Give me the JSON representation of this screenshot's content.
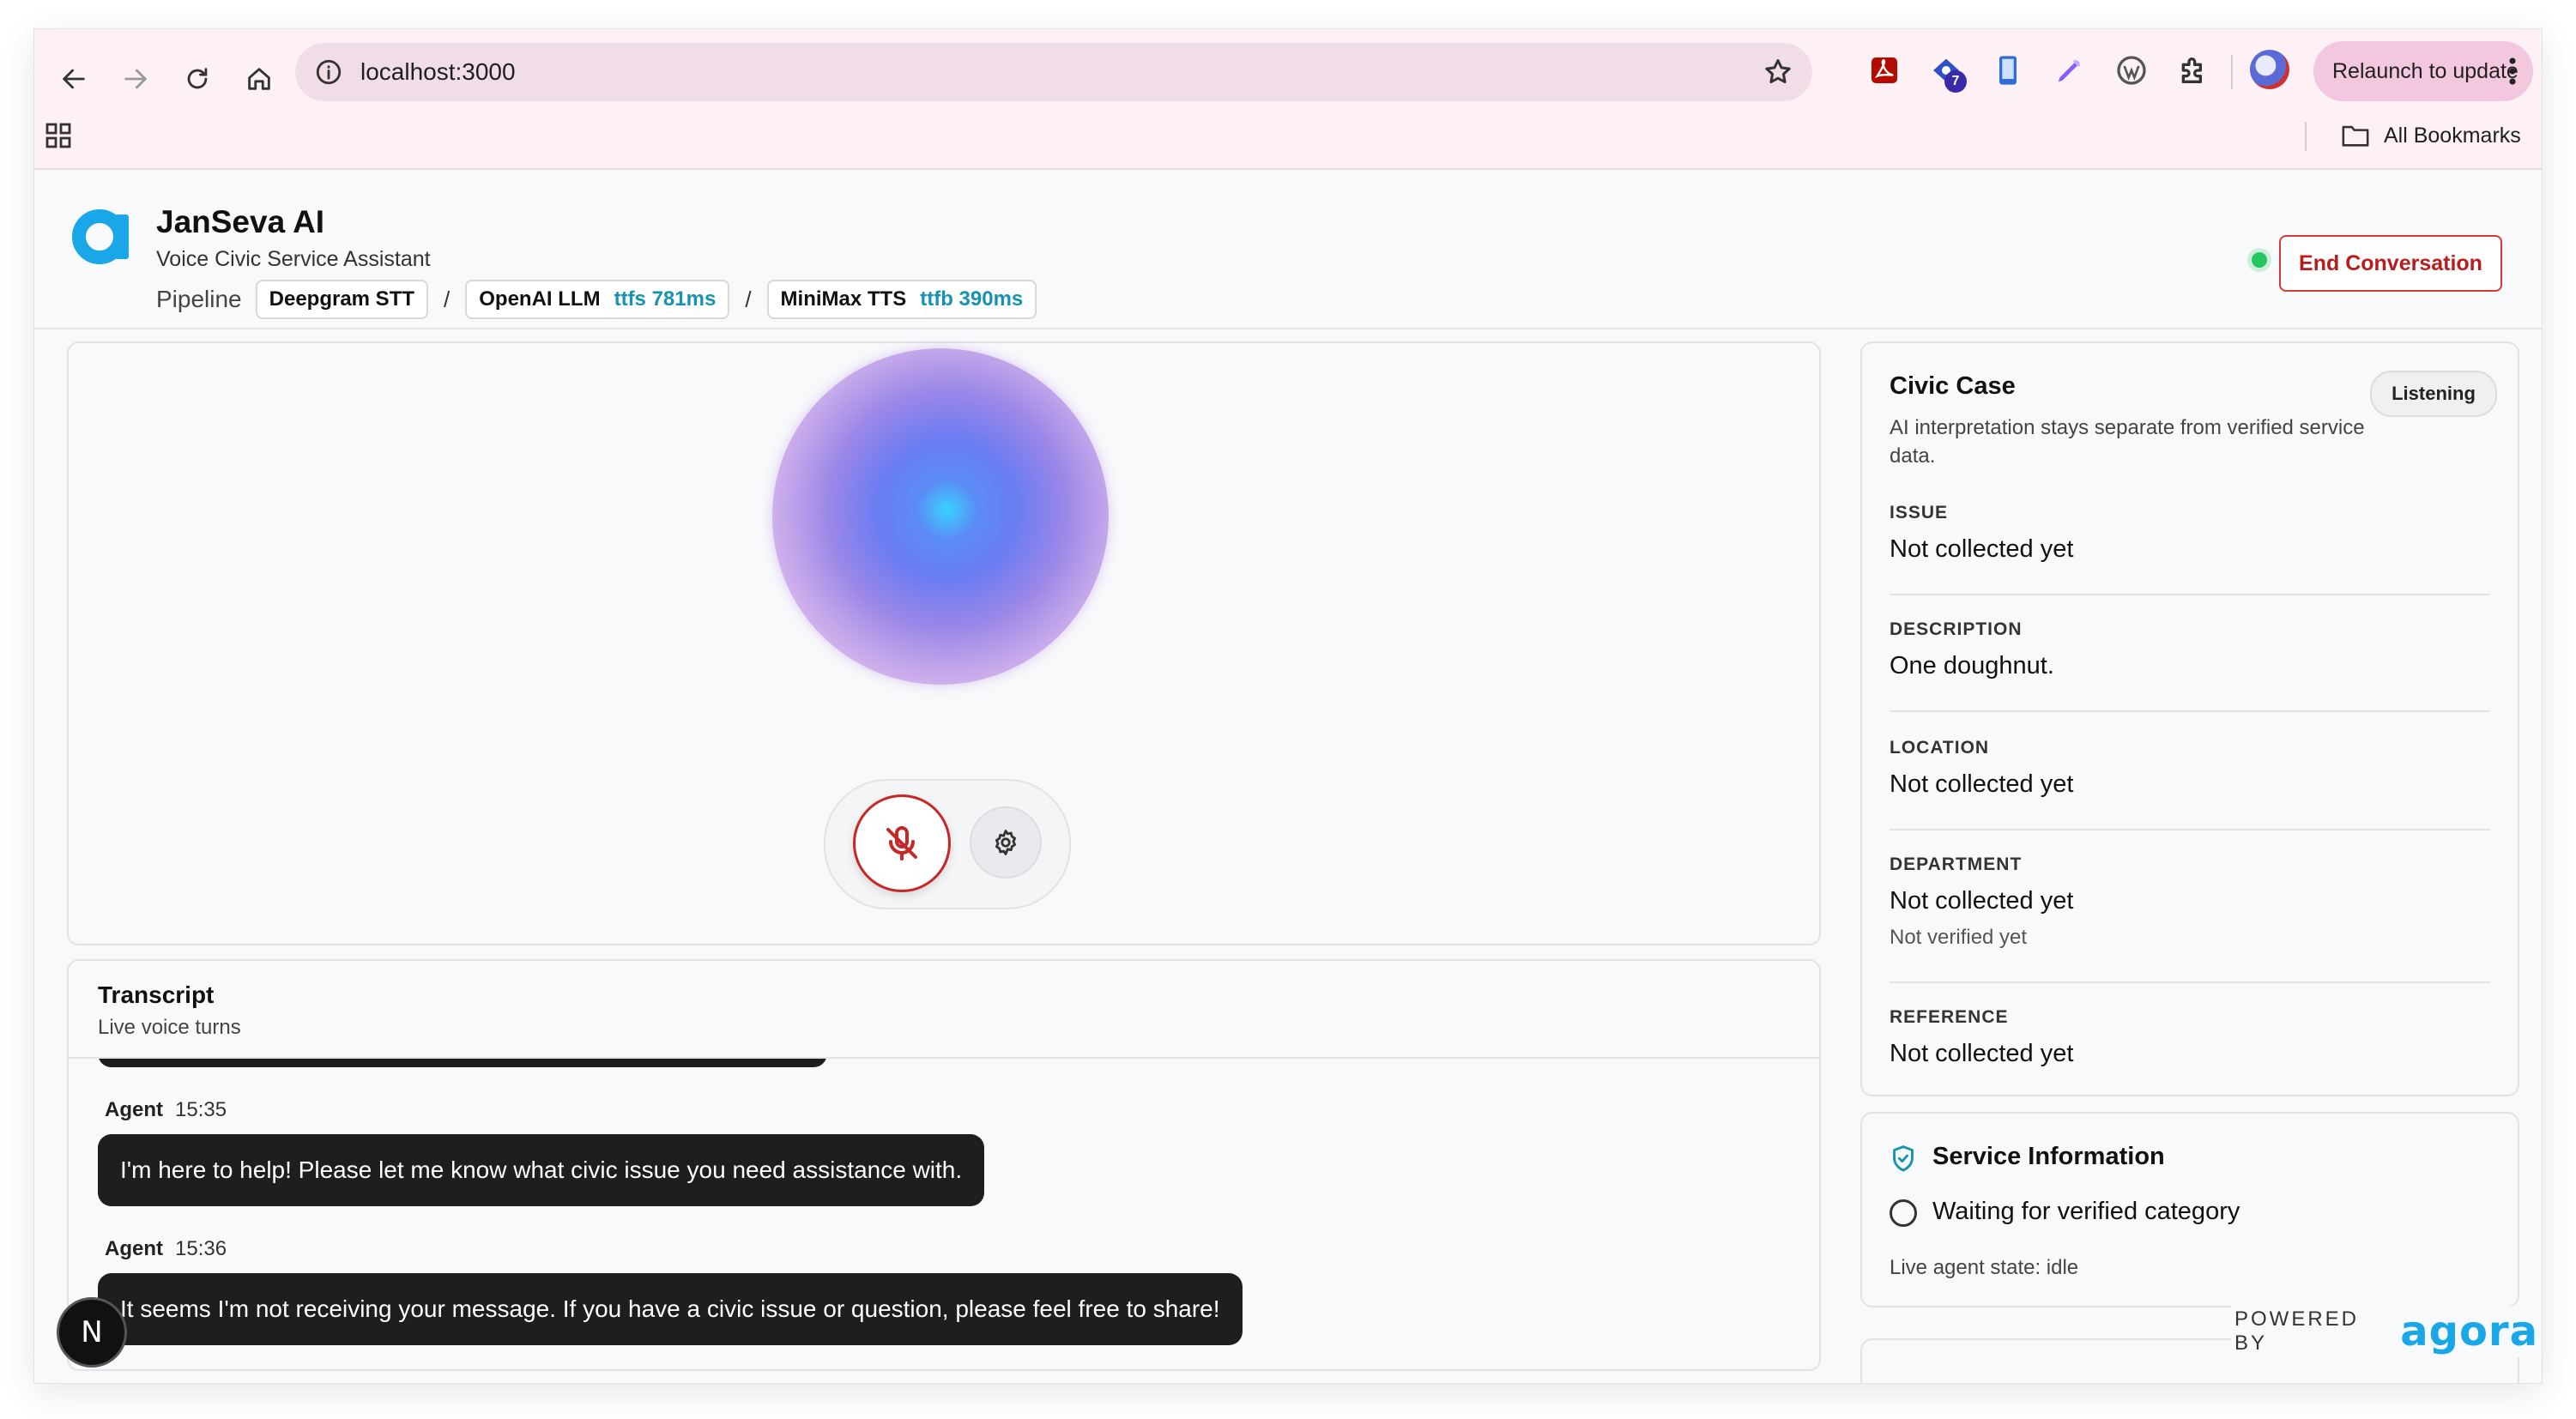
{
  "browser": {
    "url": "localhost:3000",
    "relaunch_label": "Relaunch to update",
    "extension_badge": "7",
    "bookmarks_label": "All Bookmarks"
  },
  "header": {
    "title": "JanSeva AI",
    "subtitle": "Voice Civic Service Assistant",
    "pipeline_label": "Pipeline",
    "pipeline": [
      {
        "name": "Deepgram STT",
        "metric": ""
      },
      {
        "name": "OpenAI LLM",
        "metric": "ttfs 781ms"
      },
      {
        "name": "MiniMax TTS",
        "metric": "ttfb 390ms"
      }
    ],
    "separator": "/",
    "end_button": "End Conversation",
    "status_color": "#22c55e"
  },
  "transcript": {
    "title": "Transcript",
    "subtitle": "Live voice turns",
    "messages": [
      {
        "speaker": "Agent",
        "time": "15:35",
        "text": "I'm here to help! Please let me know what civic issue you need assistance with."
      },
      {
        "speaker": "Agent",
        "time": "15:36",
        "text": "It seems I'm not receiving your message. If you have a civic issue or question, please feel free to share!"
      }
    ]
  },
  "civic_case": {
    "title": "Civic Case",
    "description": "AI interpretation stays separate from verified service data.",
    "status_badge": "Listening",
    "fields": [
      {
        "label": "ISSUE",
        "value": "Not collected yet",
        "note": ""
      },
      {
        "label": "DESCRIPTION",
        "value": "One doughnut.",
        "note": ""
      },
      {
        "label": "LOCATION",
        "value": "Not collected yet",
        "note": ""
      },
      {
        "label": "DEPARTMENT",
        "value": "Not collected yet",
        "note": "Not verified yet"
      },
      {
        "label": "REFERENCE",
        "value": "Not collected yet",
        "note": ""
      }
    ]
  },
  "service_info": {
    "title": "Service Information",
    "waiting": "Waiting for verified category",
    "agent_state": "Live agent state: idle"
  },
  "footer": {
    "powered_by": "POWERED BY",
    "brand": "agora",
    "brand_color": "#1aa7e8",
    "dev_badge": "N"
  },
  "colors": {
    "accent_red": "#c62828",
    "metric_teal": "#1792b2"
  }
}
